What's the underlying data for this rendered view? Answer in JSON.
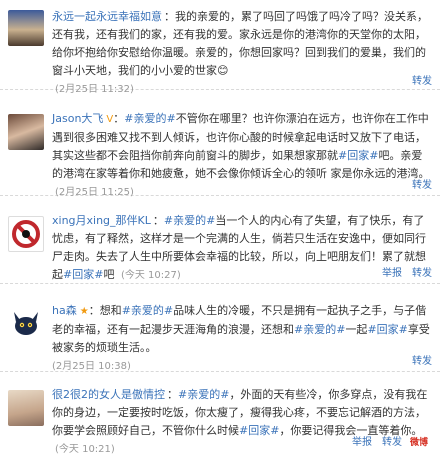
{
  "posts": [
    {
      "author": "永远一起永远幸福如意",
      "badge": "",
      "text": "我的亲爱的，累了吗回了吗饿了吗冷了吗？没关系，还有我，还有我们的家，还有我的爱。家永远是你的港湾你的天堂你的太阳，给你坏抱给你安慰给你温暖。亲爱的，你想回家吗？回到我们的爱巢，我们的窗斗小天地，我们的小小爱的世家",
      "emoji": "😊",
      "time": "(2月25日 11:32)",
      "actions": [
        "转发"
      ]
    },
    {
      "author": "Jason大飞",
      "badge": "V",
      "text_prefix": "：",
      "tag": "#亲爱的#",
      "text": "不管你在哪里？也许你漂泊在远方，也许你在工作中遇到很多困难又找不到人倾诉，也许你心酸的时候拿起电话时又放下了电话，其实这些都不会阻挡你前奔向前窗斗的脚步，如果想家那就",
      "tag2": "#回家#",
      "text2": "吧。亲爱的港湾在家等着你和她疲惫，她不会像你倾诉全心的领听 家是你永远的港湾。",
      "time": "(2月25日 11:25)",
      "actions": [
        "转发"
      ]
    },
    {
      "author": "xing月xing_那伴KL",
      "badge": "",
      "text_prefix": "：",
      "tag": "#亲爱的#",
      "text": "当一个人的内心有了失望，有了快乐，有了忧虑，有了释然，这样才是一个完满的人生，倘若只生活在安逸中，便如同行尸走肉。失去了人生中所要体会幸福的比较，所以，向上吧朋友们！累了就想起",
      "tag2": "#回家#",
      "text2": "吧",
      "time": "(今天 10:27)",
      "actions": [
        "举报",
        "转发"
      ]
    },
    {
      "author": "ha森",
      "badge": "★",
      "text_prefix": "：",
      "text": "想和",
      "tag": "#亲爱的#",
      "text_b": "品味人生的冷暖，不只是拥有一起执子之手，与子偕老的幸福，还有一起漫步天涯海角的浪漫，还想和",
      "tag2": "#亲爱的#",
      "text2": "一起",
      "tag3": "#回家#",
      "text3": "享受被家务的烦琐生活。。",
      "time": "(2月25日 10:38)",
      "actions": [
        "转发"
      ]
    },
    {
      "author": "很2很2的女人是傲情控",
      "badge": "",
      "text_prefix": "：",
      "tag": "#亲爱的#",
      "text": "，外面的天有些冷，你多穿点，没有我在你的身边，一定要按时吃饭，你太瘦了，瘦得我心疼，不要忘记解酒的方法，你要学会照顾好自己，不管你什么时候",
      "tag2": "#回家#",
      "text2": "，你要记得我会一直等着你。",
      "time": "(今天 10:21)",
      "actions": [
        "举报",
        "转发"
      ]
    }
  ],
  "logo": "微博"
}
